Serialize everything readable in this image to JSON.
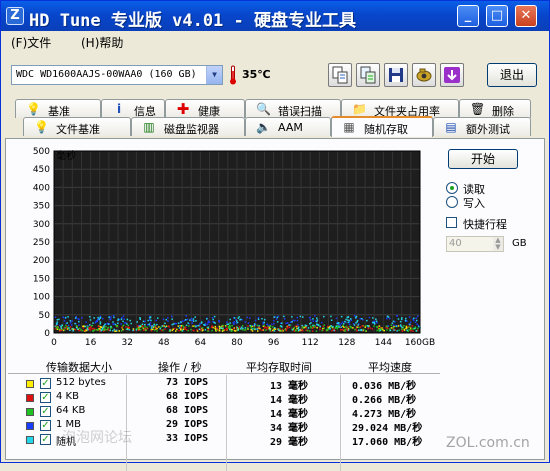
{
  "window": {
    "icon_letter": "Z",
    "title": "HD Tune 专业版 v4.01 - 硬盘专业工具",
    "minimize_glyph": "_",
    "maximize_glyph": "□",
    "close_glyph": "✕"
  },
  "menu": {
    "items": [
      "(F)文件",
      "(H)帮助"
    ]
  },
  "toolbar": {
    "drive": "WDC WD1600AAJS-00WAA0 (160 GB)",
    "temperature": "35℃",
    "exit_label": "退出",
    "icons": [
      "copy-icon",
      "copy-all-icon",
      "save-icon",
      "screenshot-icon",
      "download-icon"
    ]
  },
  "tabs_row1": [
    {
      "label": "基准",
      "icon": "bulb-icon"
    },
    {
      "label": "信息",
      "icon": "info-icon"
    },
    {
      "label": "健康",
      "icon": "health-cross-icon"
    },
    {
      "label": "错误扫描",
      "icon": "magnifier-icon"
    },
    {
      "label": "文件夹占用率",
      "icon": "folder-icon"
    },
    {
      "label": "删除",
      "icon": "trash-icon"
    }
  ],
  "tabs_row2": [
    {
      "label": "文件基准",
      "icon": "file-bulb-icon"
    },
    {
      "label": "磁盘监视器",
      "icon": "monitor-chart-icon"
    },
    {
      "label": "AAM",
      "icon": "speaker-icon"
    },
    {
      "label": "随机存取",
      "icon": "random-access-icon",
      "active": true
    },
    {
      "label": "额外测试",
      "icon": "extra-test-icon"
    }
  ],
  "side_panel": {
    "start_label": "开始",
    "read_label": "读取",
    "write_label": "写入",
    "mode": "read",
    "quick_label": "快捷行程",
    "quick_checked": false,
    "size_value": "40",
    "size_unit": "GB"
  },
  "table": {
    "headers": [
      "传输数据大小",
      "操作 / 秒",
      "平均存取时间",
      "平均速度"
    ],
    "rows": [
      {
        "size": "512 bytes",
        "color": "#ffee00",
        "ops": "73 IOPS",
        "access": "13 毫秒",
        "speed": "0.036 MB/秒"
      },
      {
        "size": "4 KB",
        "color": "#e01010",
        "ops": "68 IOPS",
        "access": "14 毫秒",
        "speed": "0.266 MB/秒"
      },
      {
        "size": "64 KB",
        "color": "#20c020",
        "ops": "68 IOPS",
        "access": "14 毫秒",
        "speed": "4.273 MB/秒"
      },
      {
        "size": "1 MB",
        "color": "#1a3cff",
        "ops": "29 IOPS",
        "access": "34 毫秒",
        "speed": "29.024 MB/秒"
      },
      {
        "size": "随机",
        "color": "#22d8e8",
        "ops": "33 IOPS",
        "access": "29 毫秒",
        "speed": "17.060 MB/秒"
      }
    ]
  },
  "watermarks": {
    "left": "泡泡网论坛",
    "right": "ZOL.com.cn"
  },
  "chart_data": {
    "type": "scatter",
    "ylabel": "毫秒",
    "ylim": [
      0,
      500
    ],
    "yticks": [
      0,
      50,
      100,
      150,
      200,
      250,
      300,
      350,
      400,
      450,
      500
    ],
    "xlim": [
      0,
      160
    ],
    "xticks": [
      "0",
      "16",
      "32",
      "48",
      "64",
      "80",
      "96",
      "112",
      "128",
      "144",
      "160GB"
    ],
    "grid": true,
    "background": "#1e1e1e",
    "series": [
      {
        "name": "512 bytes",
        "color": "#ffee00",
        "band": [
          7,
          22
        ],
        "count": 180
      },
      {
        "name": "4 KB",
        "color": "#e01010",
        "band": [
          7,
          22
        ],
        "count": 180
      },
      {
        "name": "64 KB",
        "color": "#20c020",
        "band": [
          7,
          24
        ],
        "count": 180
      },
      {
        "name": "1 MB",
        "color": "#1a3cff",
        "band": [
          22,
          50
        ],
        "count": 180
      },
      {
        "name": "随机",
        "color": "#22d8e8",
        "band": [
          8,
          48
        ],
        "count": 260
      }
    ]
  }
}
